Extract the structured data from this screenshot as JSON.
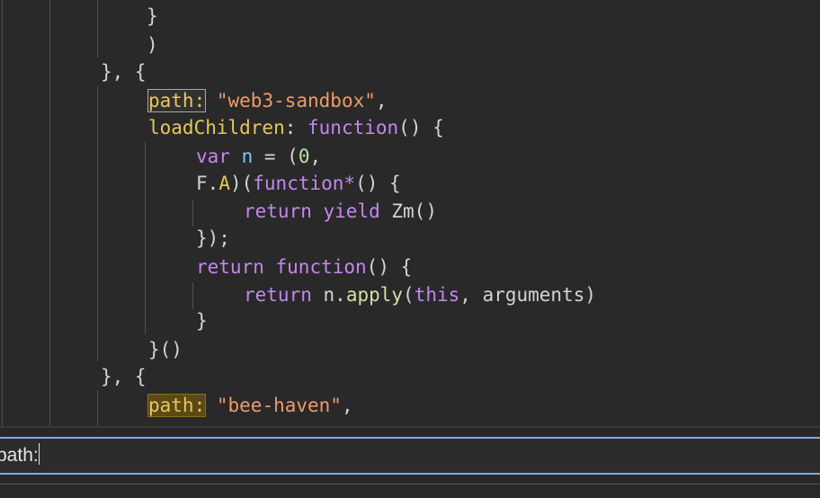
{
  "code": {
    "l0": "}",
    "l1": ")",
    "l2": "}, {",
    "l3": {
      "key": "path:",
      "val": "\"web3-sandbox\"",
      "end": ","
    },
    "l4": {
      "key": "loadChildren",
      "colon": ": ",
      "kw": "function",
      "end": "() {"
    },
    "l5": {
      "kw": "var",
      "name": "n",
      "mid": " = (",
      "num": "0",
      "end": ","
    },
    "l6": {
      "obj": "F",
      "dot": ".",
      "fn": "A",
      "p1": ")(",
      "kw": "function*",
      "end": "() {"
    },
    "l7": {
      "kw1": "return",
      "kw2": "yield",
      "call": "Zm()"
    },
    "l8": "});",
    "l9": {
      "kw1": "return",
      "kw2": "function",
      "end": "() {"
    },
    "l10": {
      "kw": "return",
      "obj": "n",
      "dot": ".",
      "fn": "apply",
      "p1": "(",
      "this": "this",
      "end": ", arguments)"
    },
    "l11": "}",
    "l12": "}()",
    "l13": "}, {",
    "l14": {
      "key": "path:",
      "val": "\"bee-haven\"",
      "end": ","
    }
  },
  "search": {
    "value": "path:"
  }
}
